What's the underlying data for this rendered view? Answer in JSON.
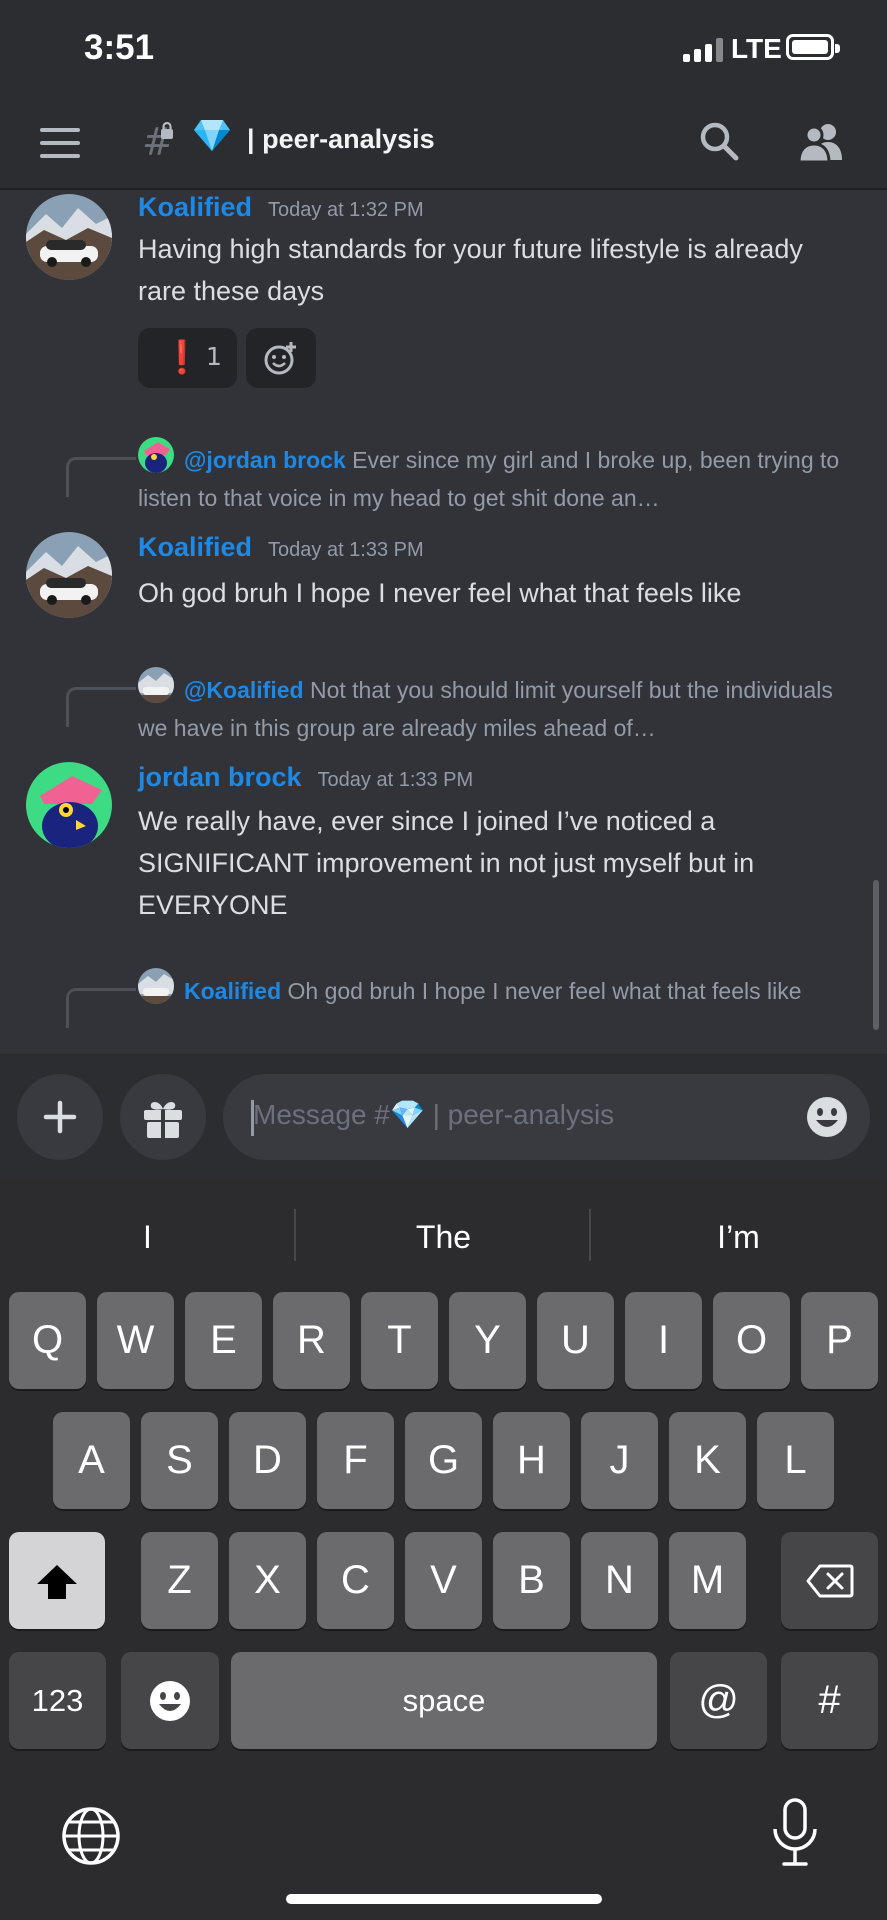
{
  "status_bar": {
    "time": "3:51",
    "network": "LTE"
  },
  "header": {
    "channel_hash": "#",
    "channel_emoji": "💎",
    "separator": "|",
    "channel_name": "peer-analysis"
  },
  "messages": [
    {
      "author": "Koalified",
      "timestamp": "Today at 1:32 PM",
      "text": "Having high standards for your future lifestyle is already rare these days",
      "reactions": [
        {
          "emoji": "❗",
          "count": "1"
        }
      ]
    },
    {
      "reply_to": {
        "author": "@jordan brock",
        "text": "Ever since my girl and I broke up, been trying to listen to that voice in my head to get shit done an…"
      },
      "author": "Koalified",
      "timestamp": "Today at 1:33 PM",
      "text": "Oh god bruh I hope I never feel what that feels like"
    },
    {
      "reply_to": {
        "author": "@Koalified",
        "text": "Not that you should limit yourself but the individuals we have in this group are already miles ahead of…"
      },
      "author": "jordan brock",
      "timestamp": "Today at 1:33 PM",
      "text": "We really have, ever since I joined I’ve noticed a SIGNIFICANT improvement in not just myself but in EVERYONE"
    },
    {
      "reply_to": {
        "author": "Koalified",
        "text": "Oh god bruh I hope I never feel what that feels like"
      }
    }
  ],
  "composer": {
    "placeholder": "Message #💎 | peer-analysis"
  },
  "keyboard": {
    "suggestions": [
      "I",
      "The",
      "I’m"
    ],
    "row1": [
      "Q",
      "W",
      "E",
      "R",
      "T",
      "Y",
      "U",
      "I",
      "O",
      "P"
    ],
    "row2": [
      "A",
      "S",
      "D",
      "F",
      "G",
      "H",
      "J",
      "K",
      "L"
    ],
    "row3": [
      "Z",
      "X",
      "C",
      "V",
      "B",
      "N",
      "M"
    ],
    "numbers_key": "123",
    "space_key": "space",
    "at_key": "@",
    "hash_key": "#"
  },
  "colors": {
    "link_blue": "#1e88e5",
    "background": "#313338",
    "header": "#2b2d31"
  }
}
